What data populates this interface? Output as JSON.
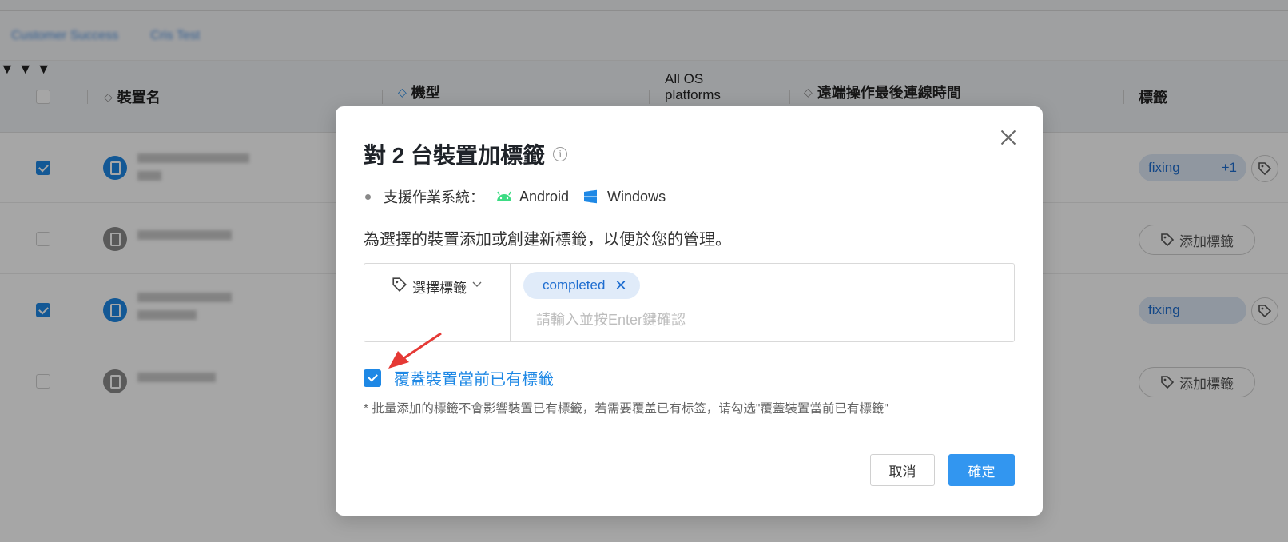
{
  "breadcrumb": [
    "Customer Success",
    "Cris Test"
  ],
  "table": {
    "columns": {
      "device_name": "裝置名",
      "model": "機型",
      "os_filter": "All OS platforms",
      "last_connection": "遠端操作最後連線時間",
      "tags": "標籤"
    },
    "rows": [
      {
        "checked": true,
        "tag": "fixing",
        "extra": "+1"
      },
      {
        "checked": false,
        "add_label": "添加標籤"
      },
      {
        "checked": true,
        "tag": "fixing"
      },
      {
        "checked": false,
        "add_label": "添加標籤"
      }
    ]
  },
  "modal": {
    "title": "對 2 台裝置加標籤",
    "info_icon": "i",
    "os_label": "支援作業系統：",
    "os": [
      "Android",
      "Windows"
    ],
    "description": "為選擇的裝置添加或創建新標籤，以便於您的管理。",
    "select_tag_label": "選擇標籤",
    "selected_tags": [
      "completed"
    ],
    "input_placeholder": "請輸入並按Enter鍵確認",
    "override_checked": true,
    "override_label": "覆蓋裝置當前已有標籤",
    "note": "* 批量添加的標籤不會影響裝置已有標籤，若需要覆盖已有标签，请勾选\"覆蓋裝置當前已有標籤\"",
    "cancel_label": "取消",
    "confirm_label": "確定"
  },
  "colors": {
    "accent": "#1e88e5",
    "primary_button": "#3296f0",
    "android": "#3ddc84",
    "windows": "#1e88e5",
    "arrow": "#e53935"
  }
}
